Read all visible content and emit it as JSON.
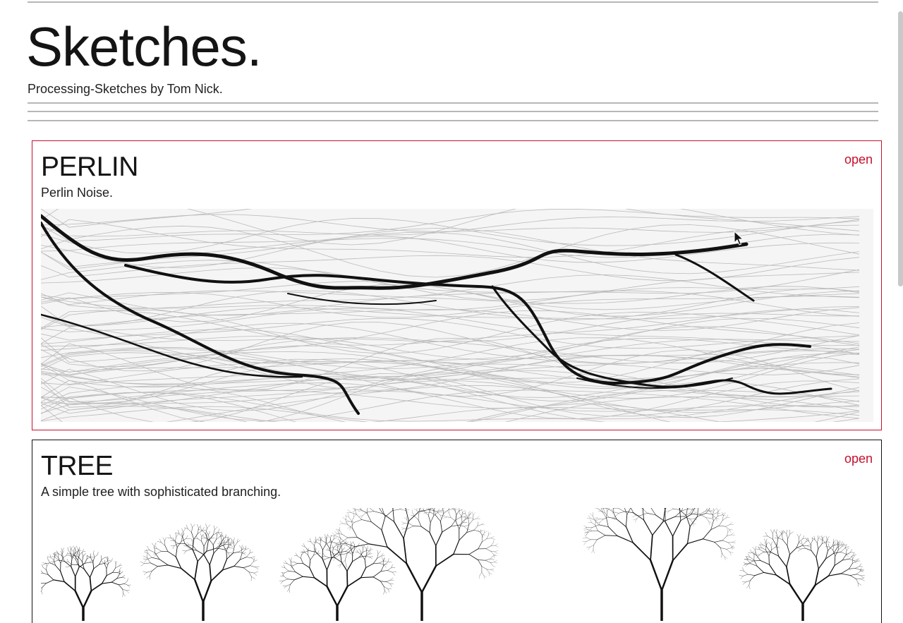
{
  "header": {
    "title": "Sketches.",
    "subtitle": "Processing-Sketches by Tom Nick."
  },
  "sketches": [
    {
      "title": "PERLIN",
      "description": "Perlin Noise.",
      "open_label": "open",
      "preview": "perlin-noise-flowfield-image"
    },
    {
      "title": "TREE",
      "description": "A simple tree with sophisticated branching.",
      "open_label": "open",
      "preview": "branching-trees-image"
    }
  ],
  "colors": {
    "accent": "#c4102c",
    "rule": "#b7b7b7",
    "text": "#1a1a1a"
  }
}
